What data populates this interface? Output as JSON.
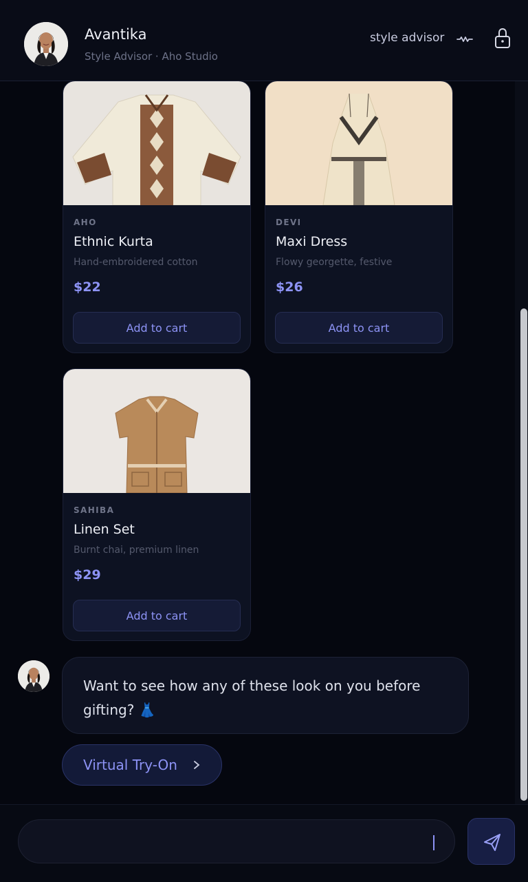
{
  "header": {
    "name": "Avantika",
    "subtitle": "Style Advisor · Aho Studio",
    "mode_label": "style advisor",
    "icons": [
      "avatar",
      "wave-icon",
      "lock-icon"
    ]
  },
  "products": [
    {
      "brand": "AHO",
      "title": "Ethnic Kurta",
      "description": "Hand-embroidered cotton",
      "price": "$22",
      "button": "Add to cart",
      "image": "ethnic-kurta-image"
    },
    {
      "brand": "DEVI",
      "title": "Maxi Dress",
      "description": "Flowy georgette, festive",
      "price": "$26",
      "button": "Add to cart",
      "image": "maxi-dress-image"
    },
    {
      "brand": "SAHIBA",
      "title": "Linen Set",
      "description": "Burnt chai, premium linen",
      "price": "$29",
      "button": "Add to cart",
      "image": "linen-set-image"
    }
  ],
  "message": {
    "text": "Want to see how any of these look on you before gifting? 👗"
  },
  "tryon": {
    "label": "Virtual Try-On"
  },
  "composer": {
    "placeholder": ""
  },
  "colors": {
    "accent": "#8d93f5",
    "background": "#05070f",
    "card": "#0d1222"
  }
}
